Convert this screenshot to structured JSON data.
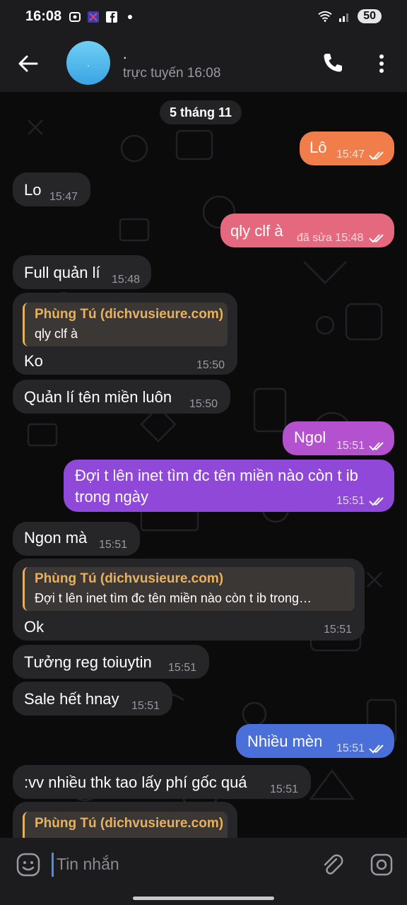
{
  "status_bar": {
    "time": "16:08",
    "battery": "50"
  },
  "header": {
    "name": ".",
    "status": "trực tuyến 16:08",
    "avatar_text": "."
  },
  "date_separator": "5 tháng 11",
  "colors": {
    "incoming": "#262628",
    "reply_accent": "#e8b15f",
    "out_gradient": [
      "#f07d4a",
      "#e4697e",
      "#c455c9",
      "#9b48d9",
      "#7a54dc",
      "#4a6fd8"
    ]
  },
  "messages": [
    {
      "dir": "out",
      "text": "Lô",
      "time": "15:47"
    },
    {
      "dir": "in",
      "text": "Lo",
      "time": "15:47"
    },
    {
      "dir": "out",
      "text": "qly clf à",
      "time": "đã sửa 15:48"
    },
    {
      "dir": "in",
      "text": "Full quản lí",
      "time": "15:48"
    },
    {
      "dir": "in",
      "reply_name": "Phùng Tú (dichvusieure.com)",
      "reply_text": "qly clf à",
      "text": "Ko",
      "time": "15:50"
    },
    {
      "dir": "in",
      "text": "Quản lí tên miền luôn",
      "time": "15:50"
    },
    {
      "dir": "out",
      "text": "Ngol",
      "time": "15:51"
    },
    {
      "dir": "out",
      "text": "Đợi t lên inet tìm đc tên miền nào còn t ib",
      "text2": "trong ngày",
      "time": "15:51"
    },
    {
      "dir": "in",
      "text": "Ngon mà",
      "time": "15:51"
    },
    {
      "dir": "in",
      "reply_name": "Phùng Tú (dichvusieure.com)",
      "reply_text": "Đợi t lên inet tìm đc tên miền nào còn t ib trong…",
      "text": "Ok",
      "time": "15:51"
    },
    {
      "dir": "in",
      "text": "Tưởng reg toiuytin",
      "time": "15:51"
    },
    {
      "dir": "in",
      "text": "Sale hết hnay",
      "time": "15:51"
    },
    {
      "dir": "out",
      "text": "Nhiều mèn",
      "time": "15:51"
    },
    {
      "dir": "in",
      "text": ":vv nhiều thk tao lấy phí gốc quá",
      "time": "15:51"
    },
    {
      "dir": "in",
      "reply_name": "Phùng Tú (dichvusieure.com)",
      "reply_text": "",
      "text": "",
      "time": ""
    }
  ],
  "input": {
    "placeholder": "Tin nhắn",
    "value": ""
  }
}
